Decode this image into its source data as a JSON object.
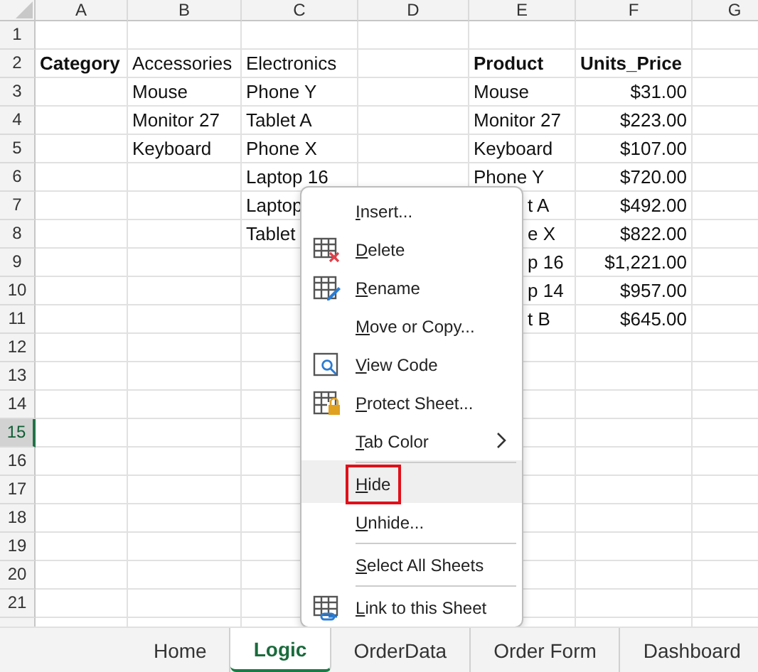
{
  "columns": [
    "A",
    "B",
    "C",
    "D",
    "E",
    "F",
    "G"
  ],
  "rows": [
    {
      "number": "1",
      "selected": false,
      "cells": [
        null,
        null,
        null,
        null,
        null,
        null,
        null
      ]
    },
    {
      "number": "2",
      "selected": false,
      "cells": [
        {
          "text": "Category",
          "bold": true
        },
        {
          "text": "Accessories"
        },
        {
          "text": "Electronics"
        },
        null,
        {
          "text": "Product",
          "bold": true
        },
        {
          "text": "Units_Price",
          "bold": true
        },
        null
      ]
    },
    {
      "number": "3",
      "selected": false,
      "cells": [
        null,
        {
          "text": "Mouse"
        },
        {
          "text": "Phone Y"
        },
        null,
        {
          "text": "Mouse"
        },
        {
          "text": "$31.00",
          "kind": "number"
        },
        null
      ]
    },
    {
      "number": "4",
      "selected": false,
      "cells": [
        null,
        {
          "text": "Monitor 27"
        },
        {
          "text": "Tablet A"
        },
        null,
        {
          "text": "Monitor 27"
        },
        {
          "text": "$223.00",
          "kind": "number"
        },
        null
      ]
    },
    {
      "number": "5",
      "selected": false,
      "cells": [
        null,
        {
          "text": "Keyboard"
        },
        {
          "text": "Phone X"
        },
        null,
        {
          "text": "Keyboard"
        },
        {
          "text": "$107.00",
          "kind": "number"
        },
        null
      ]
    },
    {
      "number": "6",
      "selected": false,
      "cells": [
        null,
        null,
        {
          "text": "Laptop 16"
        },
        null,
        {
          "text": "Phone Y"
        },
        {
          "text": "$720.00",
          "kind": "number"
        },
        null
      ]
    },
    {
      "number": "7",
      "selected": false,
      "cells": [
        null,
        null,
        {
          "text": "Laptop"
        },
        null,
        {
          "text": "t A",
          "covered": true
        },
        {
          "text": "$492.00",
          "kind": "number"
        },
        null
      ]
    },
    {
      "number": "8",
      "selected": false,
      "cells": [
        null,
        null,
        {
          "text": "Tablet"
        },
        null,
        {
          "text": "e X",
          "covered": true
        },
        {
          "text": "$822.00",
          "kind": "number"
        },
        null
      ]
    },
    {
      "number": "9",
      "selected": false,
      "cells": [
        null,
        null,
        null,
        null,
        {
          "text": "p 16",
          "covered": true
        },
        {
          "text": "$1,221.00",
          "kind": "number"
        },
        null
      ]
    },
    {
      "number": "10",
      "selected": false,
      "cells": [
        null,
        null,
        null,
        null,
        {
          "text": "p 14",
          "covered": true
        },
        {
          "text": "$957.00",
          "kind": "number"
        },
        null
      ]
    },
    {
      "number": "11",
      "selected": false,
      "cells": [
        null,
        null,
        null,
        null,
        {
          "text": "t B",
          "covered": true
        },
        {
          "text": "$645.00",
          "kind": "number"
        },
        null
      ]
    },
    {
      "number": "12",
      "selected": false,
      "cells": [
        null,
        null,
        null,
        null,
        null,
        null,
        null
      ]
    },
    {
      "number": "13",
      "selected": false,
      "cells": [
        null,
        null,
        null,
        null,
        null,
        null,
        null
      ]
    },
    {
      "number": "14",
      "selected": false,
      "cells": [
        null,
        null,
        null,
        null,
        null,
        null,
        null
      ]
    },
    {
      "number": "15",
      "selected": true,
      "cells": [
        null,
        null,
        null,
        null,
        null,
        null,
        null
      ]
    },
    {
      "number": "16",
      "selected": false,
      "cells": [
        null,
        null,
        null,
        null,
        null,
        null,
        null
      ]
    },
    {
      "number": "17",
      "selected": false,
      "cells": [
        null,
        null,
        null,
        null,
        null,
        null,
        null
      ]
    },
    {
      "number": "18",
      "selected": false,
      "cells": [
        null,
        null,
        null,
        null,
        null,
        null,
        null
      ]
    },
    {
      "number": "19",
      "selected": false,
      "cells": [
        null,
        null,
        null,
        null,
        null,
        null,
        null
      ]
    },
    {
      "number": "20",
      "selected": false,
      "cells": [
        null,
        null,
        null,
        null,
        null,
        null,
        null
      ]
    },
    {
      "number": "21",
      "selected": false,
      "cells": [
        null,
        null,
        null,
        null,
        null,
        null,
        null
      ]
    }
  ],
  "context_menu": {
    "items": [
      {
        "label": "Insert...",
        "highlighted": false,
        "separator_before": false
      },
      {
        "label": "Delete",
        "highlighted": false,
        "separator_before": false
      },
      {
        "label": "Rename",
        "highlighted": false,
        "separator_before": false
      },
      {
        "label": "Move or Copy...",
        "highlighted": false,
        "separator_before": false
      },
      {
        "label": "View Code",
        "highlighted": false,
        "separator_before": false
      },
      {
        "label": "Protect Sheet...",
        "highlighted": false,
        "separator_before": false
      },
      {
        "label": "Tab Color",
        "highlighted": false,
        "separator_before": false,
        "kind": "submenu"
      },
      {
        "label": "Hide",
        "highlighted": true,
        "separator_before": true
      },
      {
        "label": "Unhide...",
        "highlighted": false,
        "separator_before": false
      },
      {
        "label": "Select All Sheets",
        "highlighted": false,
        "separator_before": true
      },
      {
        "label": "Link to this Sheet",
        "highlighted": false,
        "separator_before": true
      }
    ]
  },
  "sheet_tabs": [
    {
      "label": "Home",
      "selected": false
    },
    {
      "label": "Logic",
      "selected": true
    },
    {
      "label": "OrderData",
      "selected": false
    },
    {
      "label": "Order Form",
      "selected": false
    },
    {
      "label": "Dashboard",
      "selected": false
    }
  ]
}
